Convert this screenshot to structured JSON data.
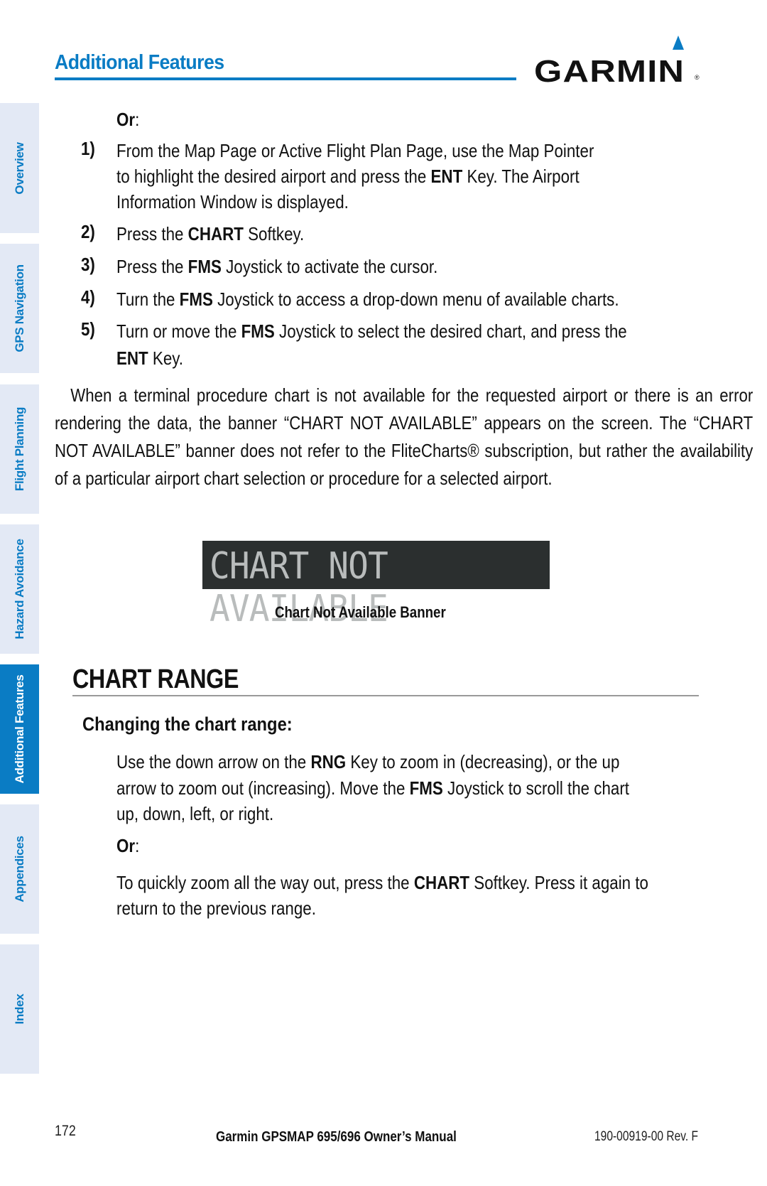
{
  "header": {
    "section_title": "Additional Features",
    "logo_text": "GARMIN",
    "logo_registered": "®",
    "accent_color": "#0a7cc4"
  },
  "side_tabs": [
    {
      "label": "Overview",
      "active": false
    },
    {
      "label": "GPS Navigation",
      "active": false
    },
    {
      "label": "Flight Planning",
      "active": false
    },
    {
      "label": "Hazard Avoidance",
      "active": false
    },
    {
      "label": "Additional Features",
      "active": true
    },
    {
      "label": "Appendices",
      "active": false
    },
    {
      "label": "Index",
      "active": false
    }
  ],
  "content": {
    "or_label": "Or",
    "or_colon": ":",
    "steps": [
      {
        "num": "1)",
        "lines": [
          [
            {
              "t": "From the Map Page or Active Flight Plan Page, use the Map Pointer"
            }
          ],
          [
            {
              "t": "to highlight the desired airport and press the "
            },
            {
              "t": "ENT",
              "b": true
            },
            {
              "t": " Key.  The Airport"
            }
          ],
          [
            {
              "t": "Information Window is displayed."
            }
          ]
        ]
      },
      {
        "num": "2)",
        "lines": [
          [
            {
              "t": "Press the "
            },
            {
              "t": "CHART",
              "b": true
            },
            {
              "t": " Softkey."
            }
          ]
        ]
      },
      {
        "num": "3)",
        "lines": [
          [
            {
              "t": "Press the "
            },
            {
              "t": "FMS",
              "b": true
            },
            {
              "t": " Joystick to activate the cursor."
            }
          ]
        ]
      },
      {
        "num": "4)",
        "lines": [
          [
            {
              "t": "Turn the "
            },
            {
              "t": "FMS",
              "b": true
            },
            {
              "t": " Joystick to access a drop-down menu of available charts."
            }
          ]
        ]
      },
      {
        "num": "5)",
        "lines": [
          [
            {
              "t": "Turn or move the "
            },
            {
              "t": "FMS",
              "b": true
            },
            {
              "t": " Joystick to select the desired chart, and press the"
            }
          ],
          [
            {
              "t": "ENT",
              "b": true
            },
            {
              "t": " Key."
            }
          ]
        ]
      }
    ],
    "paragraph": "When a terminal procedure chart is not available for the requested airport or there is an error rendering the data, the banner “CHART NOT AVAILABLE” appears on the screen.  The “CHART NOT AVAILABLE” banner does not refer to the FliteCharts® subscription, but rather the availability of a particular airport chart selection or procedure for a selected airport.",
    "banner_text": "CHART NOT AVAILABLE",
    "banner_caption": "Chart Not Available Banner",
    "section_heading": "CHART RANGE",
    "subheading": "Changing the chart range:",
    "range_para1": [
      [
        {
          "t": "Use the down arrow on the "
        },
        {
          "t": "RNG",
          "b": true
        },
        {
          "t": " Key to zoom in (decreasing), or the up"
        }
      ],
      [
        {
          "t": "arrow to zoom out (increasing).  Move the "
        },
        {
          "t": "FMS",
          "b": true
        },
        {
          "t": " Joystick to scroll the chart"
        }
      ],
      [
        {
          "t": "up, down, left, or right."
        }
      ]
    ],
    "range_para2": [
      [
        {
          "t": "To quickly zoom all the way out, press the "
        },
        {
          "t": "CHART",
          "b": true
        },
        {
          "t": " Softkey.  Press it again to"
        }
      ],
      [
        {
          "t": "return to the previous range."
        }
      ]
    ]
  },
  "footer": {
    "page_number": "172",
    "manual_title": "Garmin GPSMAP 695/696 Owner’s Manual",
    "doc_number": "190-00919-00  Rev. F"
  }
}
